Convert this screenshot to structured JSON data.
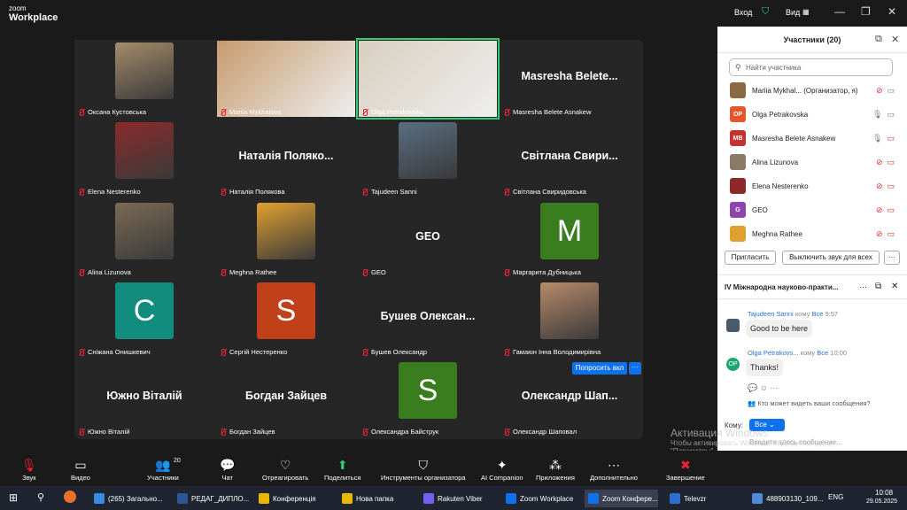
{
  "app": {
    "logo_line1": "zoom",
    "logo_line2": "Workplace",
    "login": "Вход",
    "view": "Вид"
  },
  "tiles": [
    {
      "name": "Оксана Кустовська",
      "big": "",
      "kind": "photo",
      "color": "#a58b6a"
    },
    {
      "name": "Mariia Mykhalova",
      "big": "",
      "kind": "wide",
      "color": "#c69b6d"
    },
    {
      "name": "Olga Petrakovska",
      "big": "",
      "kind": "wide2",
      "color": "#d8d0c0"
    },
    {
      "name": "Masresha Belete Asnakew",
      "big": "Masresha  Belete...",
      "kind": "text"
    },
    {
      "name": "Elena Nesterenko",
      "big": "",
      "kind": "photo",
      "color": "#8c2a2a"
    },
    {
      "name": "Наталія Полякова",
      "big": "Наталія  Поляко...",
      "kind": "text"
    },
    {
      "name": "Tajudeen Sanni",
      "big": "",
      "kind": "photo",
      "color": "#5a6e82"
    },
    {
      "name": "Світлана Свиридовська",
      "big": "Світлана  Свири...",
      "kind": "text"
    },
    {
      "name": "Alina Lizunova",
      "big": "",
      "kind": "photo",
      "color": "#7a6a55"
    },
    {
      "name": "Meghna Rathee",
      "big": "",
      "kind": "photo",
      "color": "#e0a030"
    },
    {
      "name": "GEO",
      "big": "GEO",
      "kind": "text"
    },
    {
      "name": "Маргарита Дубницька",
      "big": "M",
      "kind": "avatar",
      "color": "#3a7d1e"
    },
    {
      "name": "Сніжана Онишкевич",
      "big": "C",
      "kind": "avatar",
      "color": "#128c7e"
    },
    {
      "name": "Сергій Нестеренко",
      "big": "S",
      "kind": "avatar",
      "color": "#c0401a"
    },
    {
      "name": "Бушев Олександр",
      "big": "Бушев  Олексан...",
      "kind": "text"
    },
    {
      "name": "Гамаюн Інна Володимирівна",
      "big": "",
      "kind": "photo",
      "color": "#b88a6a"
    },
    {
      "name": "Южно Віталій",
      "big": "Южно Віталій",
      "kind": "text"
    },
    {
      "name": "Богдан Зайцев",
      "big": "Богдан Зайцев",
      "kind": "text"
    },
    {
      "name": "Олександра Байструк",
      "big": "S",
      "kind": "avatar",
      "color": "#3a7d1e"
    },
    {
      "name": "Олександр Шаповал",
      "big": "Олександр  Шап...",
      "kind": "text"
    }
  ],
  "ask_button": "Попросить вкл",
  "panel": {
    "title": "Участники (20)",
    "search_placeholder": "Найти участника",
    "participants": [
      {
        "name": "Mariia Mykhal... (Организатор, я)",
        "initials": "",
        "color": "#8a6a40"
      },
      {
        "name": "Olga Petrakovska",
        "initials": "OP",
        "color": "#e4572e"
      },
      {
        "name": "Masresha Belete Asnakew",
        "initials": "MB",
        "color": "#c4332f"
      },
      {
        "name": "Alina Lizunova",
        "initials": "",
        "color": "#8a7a66"
      },
      {
        "name": "Elena Nesterenko",
        "initials": "",
        "color": "#8c2a2a"
      },
      {
        "name": "GEO",
        "initials": "G",
        "color": "#8e44ad"
      },
      {
        "name": "Meghna Rathee",
        "initials": "",
        "color": "#e0a030"
      }
    ],
    "invite": "Пригласить",
    "mute_all": "Выключить звук для всех",
    "chat_title": "IV Міжнародна науково-практи...",
    "messages": [
      {
        "from": "Tajudeen Sanni",
        "to_word": "кому",
        "to": "Все",
        "time": "9:57",
        "text": "Good to be here"
      },
      {
        "from": "Olga Petrakovs...",
        "to_word": "кому",
        "to": "Все",
        "time": "10:00",
        "text": "Thanks!"
      }
    ],
    "who_sees": "Кто может видеть ваши сообщения?",
    "to_label": "Кому:",
    "to_value": "Все",
    "input_placeholder": "Введите здесь сообщение..."
  },
  "watermark": {
    "title": "Активация Windows",
    "sub": "Чтобы активировать Windows, перейдите в раздел \"Параметры\"."
  },
  "toolbar": [
    {
      "label": "Звук",
      "icon": "🎙"
    },
    {
      "label": "Видео",
      "icon": "▭"
    },
    {
      "label": "Участники",
      "icon": "👥",
      "count": "20"
    },
    {
      "label": "Чат",
      "icon": "💬"
    },
    {
      "label": "Отреагировать",
      "icon": "♡"
    },
    {
      "label": "Поделиться",
      "icon": "⬆"
    },
    {
      "label": "Инструменты организатора",
      "icon": "⛉"
    },
    {
      "label": "AI Companion",
      "icon": "✦"
    },
    {
      "label": "Приложения",
      "icon": "⁂"
    },
    {
      "label": "Дополнительно",
      "icon": "⋯"
    },
    {
      "label": "Завершение",
      "icon": "✖"
    }
  ],
  "taskbar": {
    "items": [
      "(265) Загально...",
      "РЕДАГ_ДИПЛО...",
      "Конференція",
      "Нова папка",
      "Rakuten Viber",
      "Zoom Workplace",
      "Zoom Конфере...",
      "Televzr",
      "488903130_109..."
    ],
    "lang": "ENG",
    "time": "10:08",
    "date": "29.05.2025"
  }
}
